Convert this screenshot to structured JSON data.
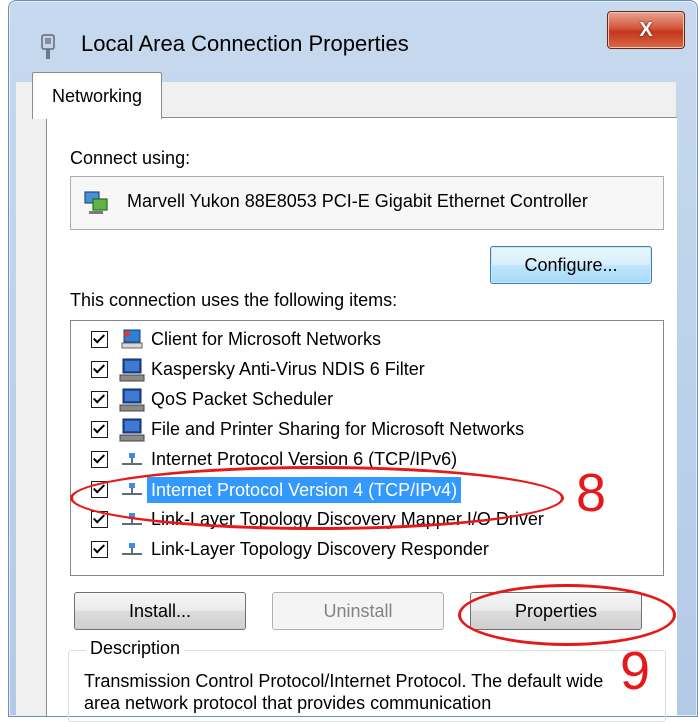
{
  "window": {
    "title": "Local Area Connection Properties",
    "close_label": "X"
  },
  "tabs": [
    {
      "label": "Networking"
    }
  ],
  "connect_using": {
    "label": "Connect using:",
    "adapter": "Marvell Yukon 88E8053 PCI-E Gigabit Ethernet Controller",
    "configure_label": "Configure..."
  },
  "items_section": {
    "label": "This connection uses the following items:",
    "items": [
      {
        "label": "Client for Microsoft Networks",
        "checked": true,
        "icon": "network-client-icon"
      },
      {
        "label": "Kaspersky Anti-Virus NDIS 6 Filter",
        "checked": true,
        "icon": "computer-icon"
      },
      {
        "label": "QoS Packet Scheduler",
        "checked": true,
        "icon": "computer-icon"
      },
      {
        "label": "File and Printer Sharing for Microsoft Networks",
        "checked": true,
        "icon": "computer-icon"
      },
      {
        "label": "Internet Protocol Version 6 (TCP/IPv6)",
        "checked": true,
        "icon": "protocol-icon"
      },
      {
        "label": "Internet Protocol Version 4 (TCP/IPv4)",
        "checked": true,
        "icon": "protocol-icon",
        "selected": true
      },
      {
        "label": "Link-Layer Topology Discovery Mapper I/O Driver",
        "checked": true,
        "icon": "protocol-icon"
      },
      {
        "label": "Link-Layer Topology Discovery Responder",
        "checked": true,
        "icon": "protocol-icon"
      }
    ]
  },
  "buttons": {
    "install": "Install...",
    "uninstall": "Uninstall",
    "properties": "Properties"
  },
  "description": {
    "legend": "Description",
    "text": "Transmission Control Protocol/Internet Protocol. The default wide area network protocol that provides communication"
  },
  "annotations": {
    "step8": "8",
    "step9": "9",
    "color": "#e51919"
  },
  "colors": {
    "selection": "#3399ff",
    "close_button": "#c4381b"
  }
}
